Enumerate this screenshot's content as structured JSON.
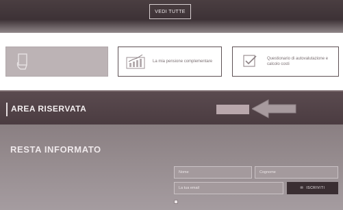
{
  "top": {
    "vedi_tutte": "VEDI TUTTE"
  },
  "cards": {
    "card1": {
      "text": ""
    },
    "card2": {
      "text": "La mia pensione complementare"
    },
    "card3": {
      "text": "Questionario di autovalutazione e calcolo costi"
    }
  },
  "area": {
    "title": "AREA RISERVATA",
    "button": ""
  },
  "resta": {
    "title": "RESTA INFORMATO",
    "subtitle": "",
    "nome_placeholder": "Nome",
    "cognome_placeholder": "Cognome",
    "email_placeholder": "La tua email",
    "iscriviti": "ISCRIVITI",
    "privacy": ""
  },
  "colors": {
    "dark_band": "#4a3e41",
    "button_dark": "#3a2e32",
    "accent_light": "#b9a7ac"
  }
}
